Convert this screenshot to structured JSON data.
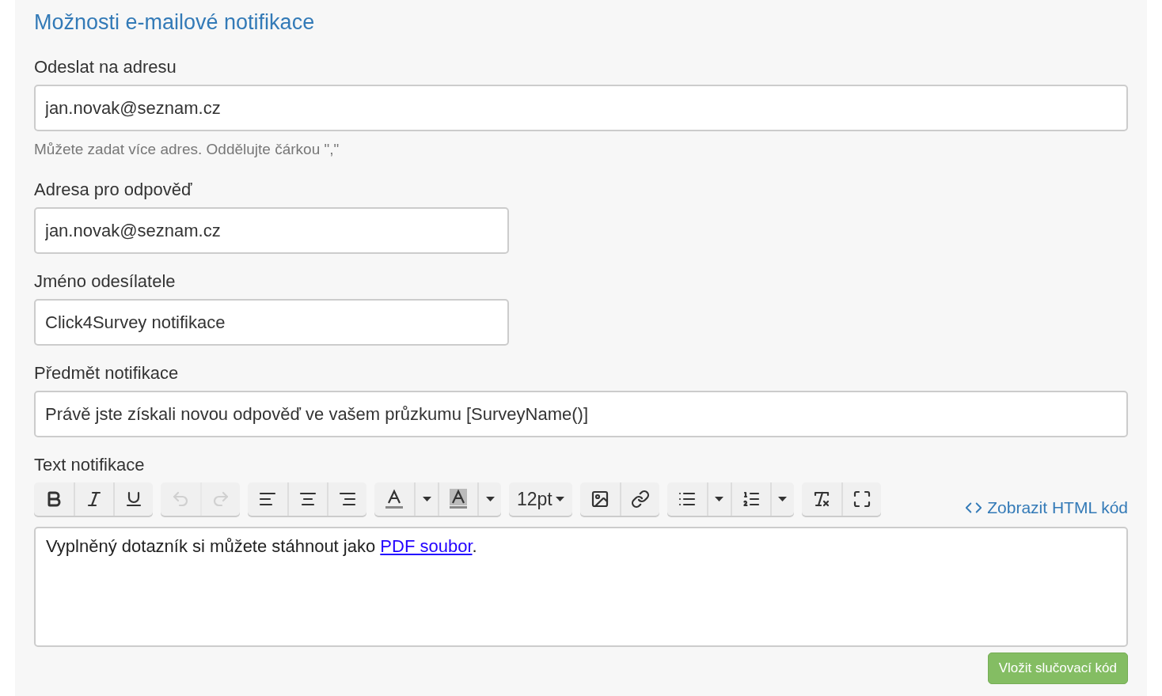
{
  "title": "Možnosti e-mailové notifikace",
  "fields": [
    {
      "label": "Odeslat na adresu",
      "value": "jan.novak@seznam.cz",
      "wide": true,
      "help": "Můžete zadat více adres. Oddělujte čárkou \",\""
    },
    {
      "label": "Adresa pro odpověď",
      "value": "jan.novak@seznam.cz",
      "wide": false
    },
    {
      "label": "Jméno odesílatele",
      "value": "Click4Survey notifikace",
      "wide": false
    },
    {
      "label": "Předmět notifikace",
      "value": "Právě jste získali novou odpověď ve vašem průzkumu [SurveyName()]",
      "wide": true
    }
  ],
  "editor": {
    "label": "Text notifikace",
    "toolbar": [
      [
        {
          "kind": "bold",
          "disabled": false
        },
        {
          "kind": "italic",
          "disabled": false
        },
        {
          "kind": "underline",
          "disabled": false
        }
      ],
      [
        {
          "kind": "undo",
          "disabled": true
        },
        {
          "kind": "redo",
          "disabled": true
        }
      ],
      [
        {
          "kind": "align-left",
          "disabled": false
        },
        {
          "kind": "align-center",
          "disabled": false
        },
        {
          "kind": "align-right",
          "disabled": false
        }
      ],
      [
        {
          "kind": "font-color",
          "disabled": false
        },
        {
          "kind": "caret",
          "disabled": false
        },
        {
          "kind": "background-color",
          "disabled": false
        },
        {
          "kind": "caret",
          "disabled": false
        }
      ],
      [
        {
          "kind": "font-size",
          "disabled": false,
          "label": "12pt"
        }
      ],
      [
        {
          "kind": "image",
          "disabled": false
        },
        {
          "kind": "link",
          "disabled": false
        }
      ],
      [
        {
          "kind": "bullet-list",
          "disabled": false
        },
        {
          "kind": "caret",
          "disabled": false
        },
        {
          "kind": "numbered-list",
          "disabled": false
        },
        {
          "kind": "caret",
          "disabled": false
        }
      ],
      [
        {
          "kind": "clear-format",
          "disabled": false
        },
        {
          "kind": "fullscreen",
          "disabled": false
        }
      ]
    ],
    "html_toggle": "Zobrazit HTML kód",
    "content": {
      "before": "Vyplněný dotazník si můžete stáhnout jako ",
      "link": "PDF soubor",
      "after": "."
    }
  },
  "insert_button": "Vložit slučovací kód"
}
